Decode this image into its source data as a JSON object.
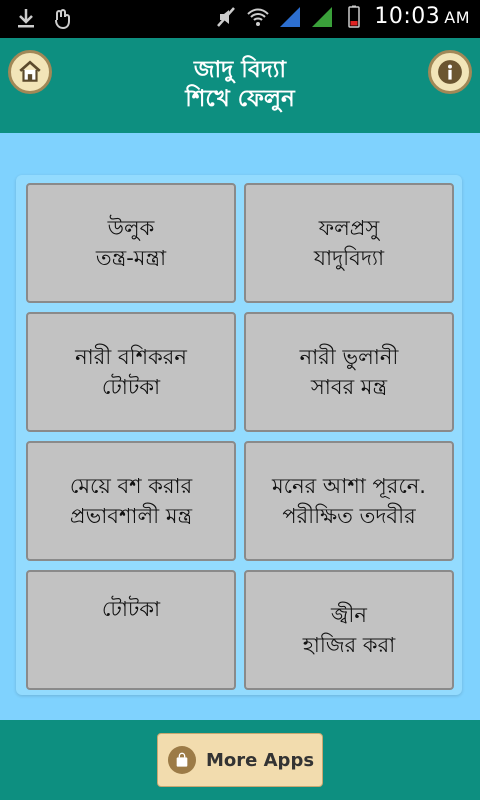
{
  "status_bar": {
    "time": "10:03",
    "ampm": "AM",
    "icons": [
      "download-icon",
      "hand-icon",
      "mute-icon",
      "wifi-icon",
      "signal-icon",
      "signal-icon-2",
      "battery-icon"
    ]
  },
  "header": {
    "title_line1": "জাদু বিদ্যা",
    "title_line2": "শিখে ফেলুন",
    "home_icon": "home-icon",
    "info_icon": "info-icon"
  },
  "grid": {
    "tiles": [
      {
        "line1": "উলুক",
        "line2": "তন্ত্র-মন্ত্রা"
      },
      {
        "line1": "ফলপ্রসু",
        "line2": "যাদুবিদ্যা"
      },
      {
        "line1": "নারী বশিকরন",
        "line2": "টোটকা"
      },
      {
        "line1": "নারী ভুলানী",
        "line2": "সাবর মন্ত্র"
      },
      {
        "line1": "মেয়ে বশ করার",
        "line2": "প্রভাবশালী মন্ত্র"
      },
      {
        "line1": "মনের আশা পূরনে.",
        "line2": "পরীক্ষিত তদবীর"
      },
      {
        "line1": "টোটকা",
        "line2": ""
      },
      {
        "line1": "জ্বীন",
        "line2": "হাজির করা"
      }
    ]
  },
  "footer": {
    "more_apps_label": "More Apps",
    "bag_icon": "shopping-bag-icon"
  },
  "colors": {
    "teal": "#0d8f80",
    "sky": "#7fd2fe",
    "tile": "#c2c2c2",
    "button": "#f2dcae"
  }
}
